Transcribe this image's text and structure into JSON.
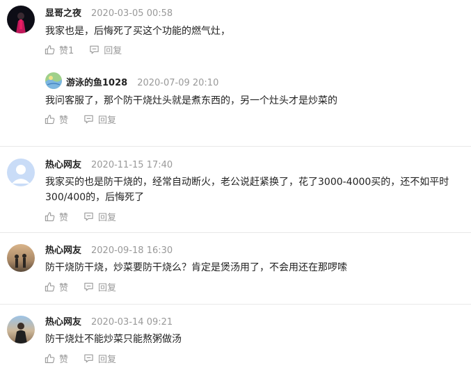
{
  "comments": [
    {
      "user": "显哥之夜",
      "time": "2020-03-05 00:58",
      "text": "我家也是，后悔死了买这个功能的燃气灶，",
      "like_label": "赞1",
      "reply_label": "回复",
      "reply": {
        "user": "游泳的鱼1028",
        "time": "2020-07-09 20:10",
        "text": "我问客服了，那个防干烧灶头就是煮东西的，另一个灶头才是炒菜的",
        "like_label": "赞",
        "reply_label": "回复"
      }
    },
    {
      "user": "热心网友",
      "time": "2020-11-15 17:40",
      "text": "我家买的也是防干烧的，经常自动断火，老公说赶紧换了，花了3000-4000买的，还不如平时300/400的，后悔死了",
      "like_label": "赞",
      "reply_label": "回复"
    },
    {
      "user": "热心网友",
      "time": "2020-09-18 16:30",
      "text": "防干烧防干烧，炒菜要防干烧么？肯定是煲汤用了，不会用还在那啰嗦",
      "like_label": "赞",
      "reply_label": "回复"
    },
    {
      "user": "热心网友",
      "time": "2020-03-14 09:21",
      "text": "防干烧灶不能炒菜只能熬粥做汤",
      "like_label": "赞",
      "reply_label": "回复"
    }
  ],
  "colors": {
    "meta_gray": "#999999",
    "text": "#222222",
    "divider": "#e8e8e8"
  }
}
